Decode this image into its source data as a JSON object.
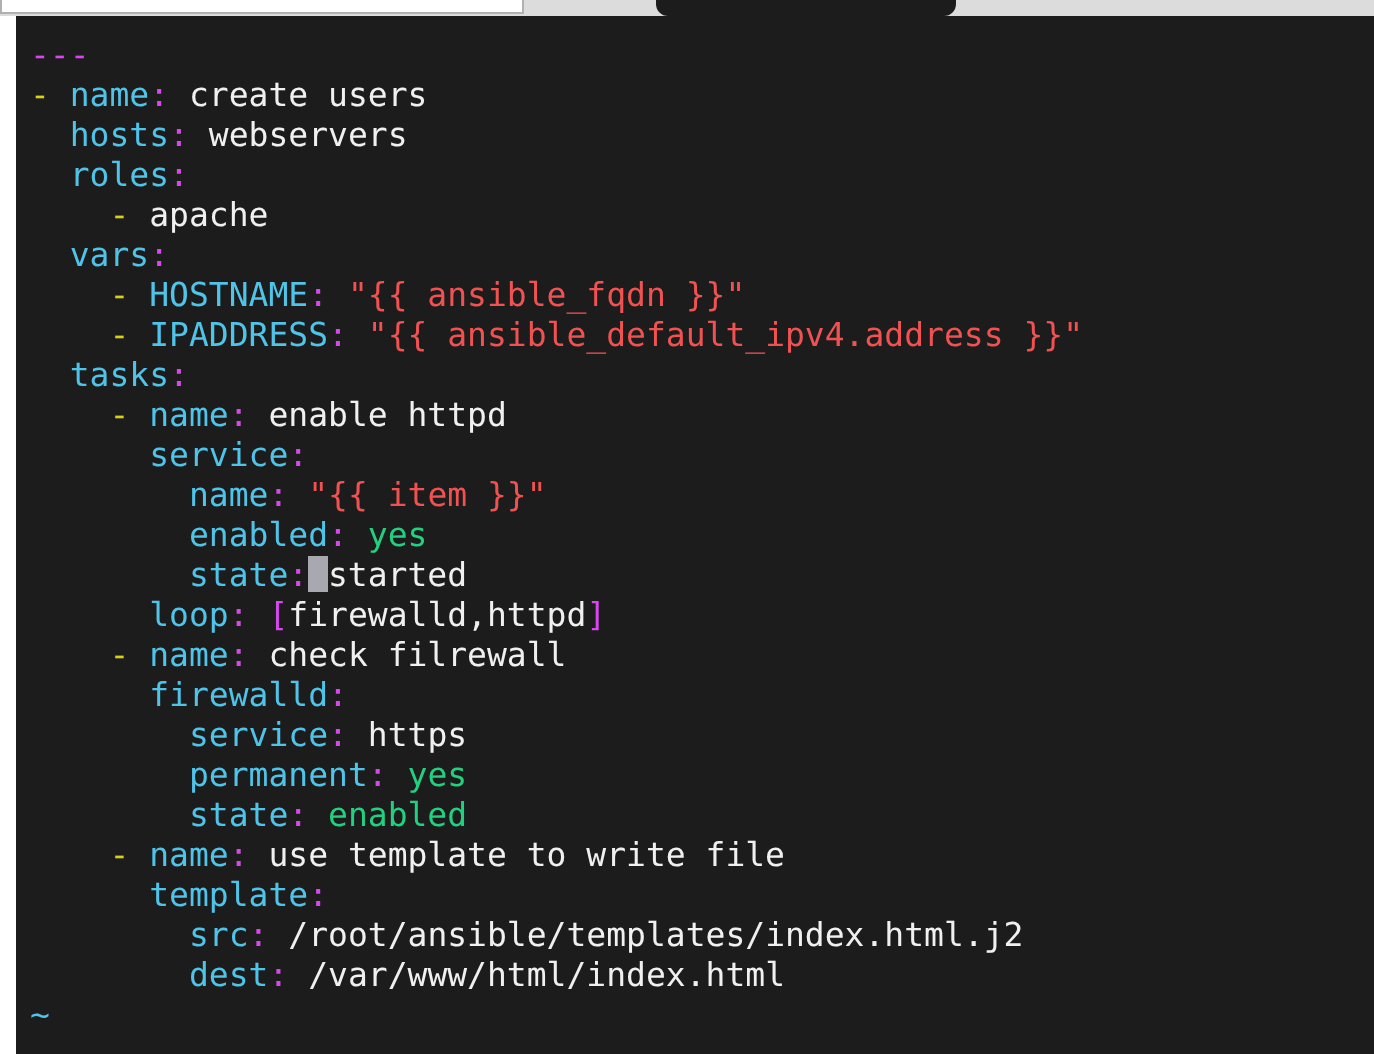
{
  "lines": [
    [
      {
        "text": "---",
        "kind": "doc"
      }
    ],
    [
      {
        "text": "-",
        "kind": "dash"
      },
      {
        "text": " name",
        "kind": "key"
      },
      {
        "text": ":",
        "kind": "punct"
      },
      {
        "text": " create users",
        "kind": "text"
      }
    ],
    [
      {
        "text": "  hosts",
        "kind": "key"
      },
      {
        "text": ":",
        "kind": "punct"
      },
      {
        "text": " webservers",
        "kind": "text"
      }
    ],
    [
      {
        "text": "  roles",
        "kind": "key"
      },
      {
        "text": ":",
        "kind": "punct"
      }
    ],
    [
      {
        "text": "    -",
        "kind": "dash"
      },
      {
        "text": " apache",
        "kind": "text"
      }
    ],
    [
      {
        "text": "  vars",
        "kind": "key"
      },
      {
        "text": ":",
        "kind": "punct"
      }
    ],
    [
      {
        "text": "    -",
        "kind": "dash"
      },
      {
        "text": " HOSTNAME",
        "kind": "key"
      },
      {
        "text": ":",
        "kind": "punct"
      },
      {
        "text": " \"{{ ansible_fqdn }}\"",
        "kind": "string"
      }
    ],
    [
      {
        "text": "    -",
        "kind": "dash"
      },
      {
        "text": " IPADDRESS",
        "kind": "key"
      },
      {
        "text": ":",
        "kind": "punct"
      },
      {
        "text": " \"{{ ansible_default_ipv4.address }}\"",
        "kind": "string"
      }
    ],
    [
      {
        "text": "  tasks",
        "kind": "key"
      },
      {
        "text": ":",
        "kind": "punct"
      }
    ],
    [
      {
        "text": "    -",
        "kind": "dash"
      },
      {
        "text": " name",
        "kind": "key"
      },
      {
        "text": ":",
        "kind": "punct"
      },
      {
        "text": " enable httpd",
        "kind": "text"
      }
    ],
    [
      {
        "text": "      service",
        "kind": "key"
      },
      {
        "text": ":",
        "kind": "punct"
      }
    ],
    [
      {
        "text": "        name",
        "kind": "key"
      },
      {
        "text": ":",
        "kind": "punct"
      },
      {
        "text": " \"{{ item }}\"",
        "kind": "string"
      }
    ],
    [
      {
        "text": "        enabled",
        "kind": "key"
      },
      {
        "text": ":",
        "kind": "punct"
      },
      {
        "text": " yes",
        "kind": "bool"
      }
    ],
    [
      {
        "text": "        state",
        "kind": "key"
      },
      {
        "text": ":",
        "kind": "punct"
      },
      {
        "kind": "cursor"
      },
      {
        "text": "started",
        "kind": "text"
      }
    ],
    [
      {
        "text": "      loop",
        "kind": "key"
      },
      {
        "text": ":",
        "kind": "punct"
      },
      {
        "text": " [",
        "kind": "bracket"
      },
      {
        "text": "firewalld,httpd",
        "kind": "text"
      },
      {
        "text": "]",
        "kind": "bracket"
      }
    ],
    [
      {
        "text": "    -",
        "kind": "dash"
      },
      {
        "text": " name",
        "kind": "key"
      },
      {
        "text": ":",
        "kind": "punct"
      },
      {
        "text": " check filrewall",
        "kind": "text"
      }
    ],
    [
      {
        "text": "      firewalld",
        "kind": "key"
      },
      {
        "text": ":",
        "kind": "punct"
      }
    ],
    [
      {
        "text": "        service",
        "kind": "key"
      },
      {
        "text": ":",
        "kind": "punct"
      },
      {
        "text": " https",
        "kind": "text"
      }
    ],
    [
      {
        "text": "        permanent",
        "kind": "key"
      },
      {
        "text": ":",
        "kind": "punct"
      },
      {
        "text": " yes",
        "kind": "bool"
      }
    ],
    [
      {
        "text": "        state",
        "kind": "key"
      },
      {
        "text": ":",
        "kind": "punct"
      },
      {
        "text": " enabled",
        "kind": "bool"
      }
    ],
    [
      {
        "text": "    -",
        "kind": "dash"
      },
      {
        "text": " name",
        "kind": "key"
      },
      {
        "text": ":",
        "kind": "punct"
      },
      {
        "text": " use template to write file",
        "kind": "text"
      }
    ],
    [
      {
        "text": "      template",
        "kind": "key"
      },
      {
        "text": ":",
        "kind": "punct"
      }
    ],
    [
      {
        "text": "        src",
        "kind": "key"
      },
      {
        "text": ":",
        "kind": "punct"
      },
      {
        "text": " /root/ansible/templates/index.html.j2",
        "kind": "text"
      }
    ],
    [
      {
        "text": "        dest",
        "kind": "key"
      },
      {
        "text": ":",
        "kind": "punct"
      },
      {
        "text": " /var/www/html/index.html",
        "kind": "text"
      }
    ],
    [
      {
        "text": "~",
        "kind": "tilde"
      }
    ]
  ]
}
